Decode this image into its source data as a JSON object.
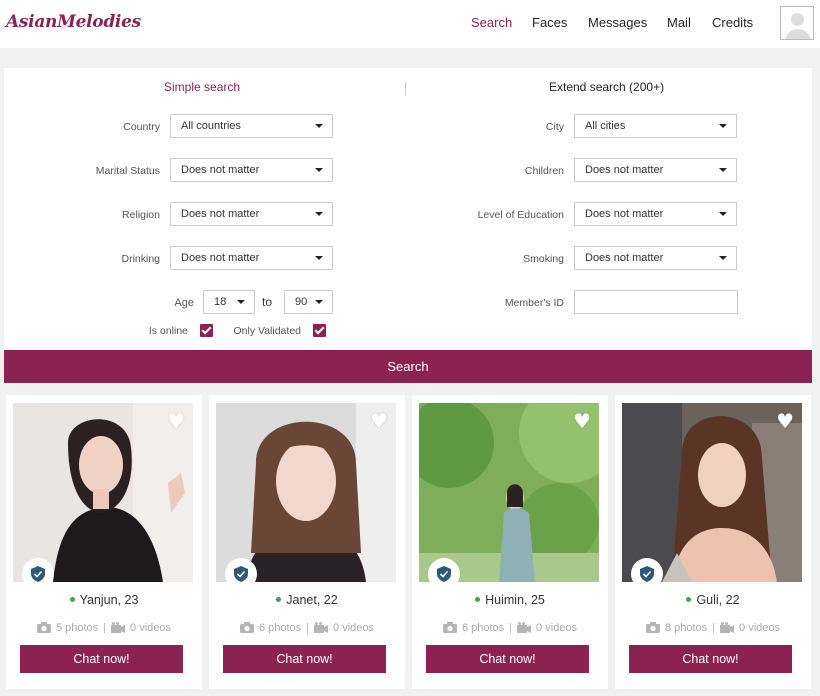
{
  "header": {
    "logo": "AsianMelodies",
    "nav": [
      "Search",
      "Faces",
      "Messages",
      "Mail",
      "Credits"
    ]
  },
  "search": {
    "tab_simple": "Simple search",
    "tab_extend": "Extend search (200+)",
    "country_label": "Country",
    "country_value": "All countries",
    "marital_label": "Marital Status",
    "marital_value": "Does not matter",
    "religion_label": "Religion",
    "religion_value": "Does not matter",
    "drinking_label": "Drinking",
    "drinking_value": "Does not matter",
    "city_label": "City",
    "city_value": "All cities",
    "children_label": "Children",
    "children_value": "Does not matter",
    "education_label": "Level of Education",
    "education_value": "Does not matter",
    "smoking_label": "Smoking",
    "smoking_value": "Does not matter",
    "age_label": "Age",
    "age_from": "18",
    "age_to_label": "to",
    "age_to": "90",
    "member_id_label": "Member's ID",
    "member_id_value": "",
    "online_label": "Is online",
    "online_checked": true,
    "validated_label": "Only Validated",
    "validated_checked": true,
    "button": "Search"
  },
  "profiles": [
    {
      "name": "Yanjun, 23",
      "photos": "5 photos",
      "videos": "0 videos",
      "chat": "Chat now!"
    },
    {
      "name": "Janet, 22",
      "photos": "6 photos",
      "videos": "0 videos",
      "chat": "Chat now!"
    },
    {
      "name": "Huimin, 25",
      "photos": "6 photos",
      "videos": "0 videos",
      "chat": "Chat now!"
    },
    {
      "name": "Guli, 22",
      "photos": "8 photos",
      "videos": "0 videos",
      "chat": "Chat now!"
    }
  ],
  "colors": {
    "accent": "#8b2252",
    "online": "#3aa655"
  },
  "icons": [
    "heart-icon",
    "shield-check-icon",
    "camera-icon",
    "video-icon",
    "caret-down-icon"
  ]
}
